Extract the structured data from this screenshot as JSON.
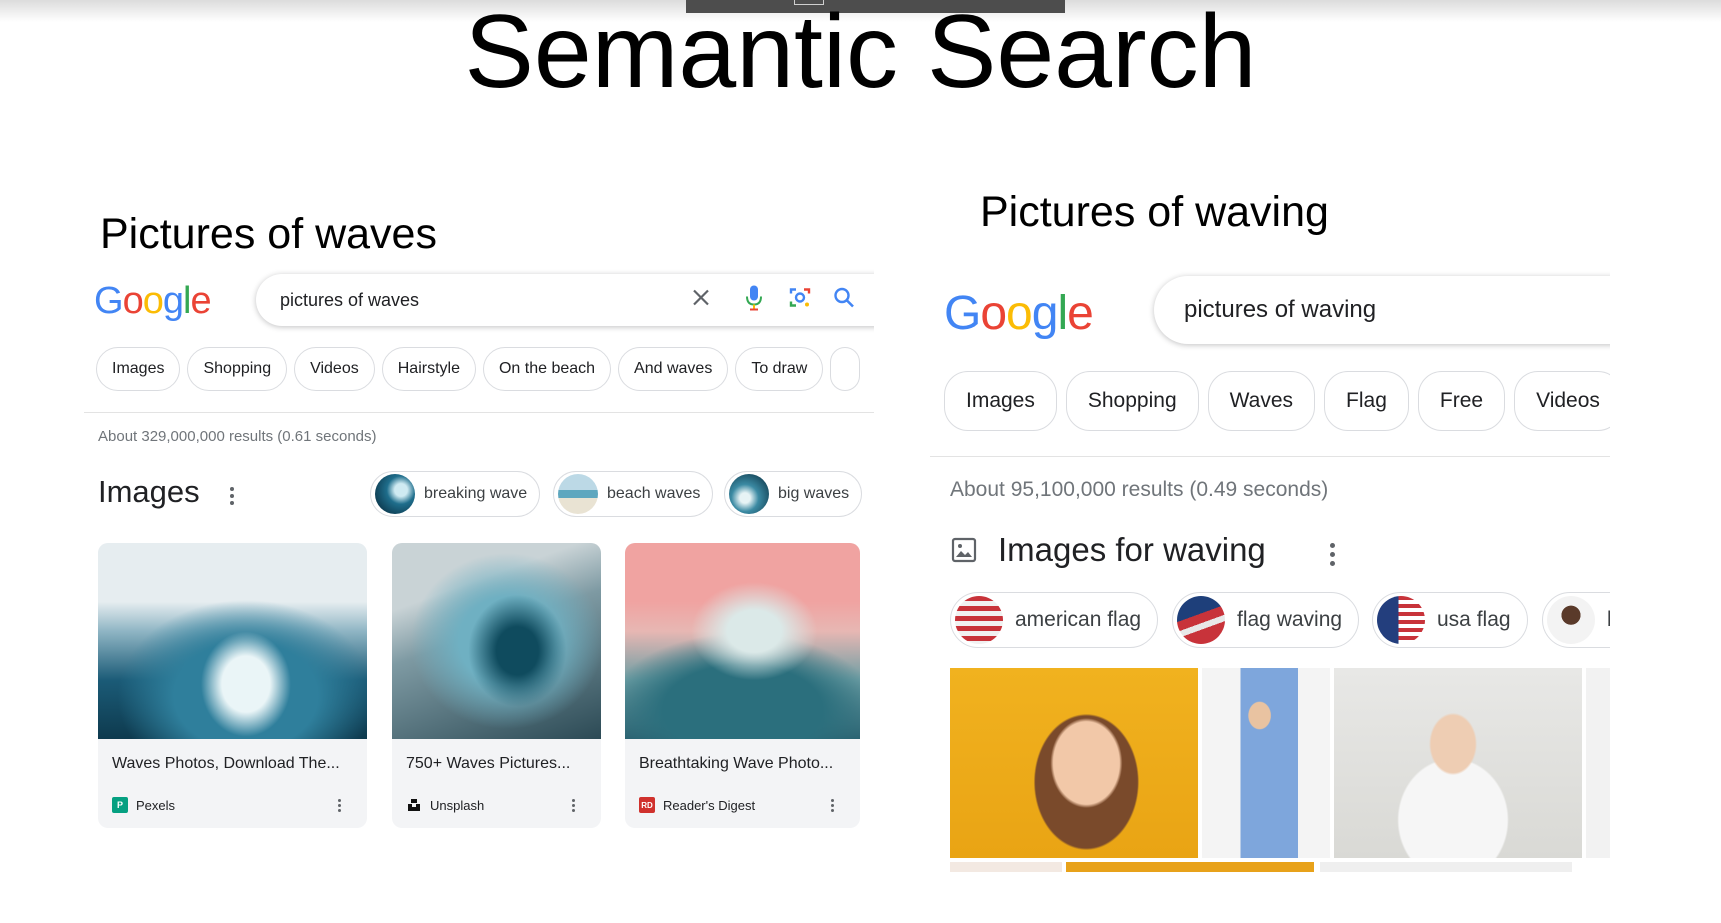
{
  "slide": {
    "title": "Semantic Search"
  },
  "left": {
    "heading": "Pictures of waves",
    "logo": [
      "G",
      "o",
      "o",
      "g",
      "l",
      "e"
    ],
    "search": {
      "value": "pictures of waves"
    },
    "chips": [
      "Images",
      "Shopping",
      "Videos",
      "Hairstyle",
      "On the beach",
      "And waves",
      "To draw"
    ],
    "result_count": "About 329,000,000 results (0.61 seconds)",
    "section_title": "Images",
    "related": [
      {
        "label": "breaking wave"
      },
      {
        "label": "beach waves"
      },
      {
        "label": "big waves"
      }
    ],
    "cards": [
      {
        "title": "Waves Photos, Download The...",
        "source": "Pexels",
        "favicon": "P",
        "favicon_color": "#05a081"
      },
      {
        "title": "750+ Waves Pictures...",
        "source": "Unsplash",
        "favicon": "",
        "favicon_color": "#111111"
      },
      {
        "title": "Breathtaking Wave Photo...",
        "source": "Reader's Digest",
        "favicon": "RD",
        "favicon_color": "#d0312d"
      }
    ]
  },
  "right": {
    "heading": "Pictures of waving",
    "logo": [
      "G",
      "o",
      "o",
      "g",
      "l",
      "e"
    ],
    "search": {
      "value": "pictures of waving"
    },
    "chips": [
      "Images",
      "Shopping",
      "Waves",
      "Flag",
      "Free",
      "Videos"
    ],
    "result_count": "About 95,100,000 results (0.49 seconds)",
    "section_title": "Images for waving",
    "related": [
      {
        "label": "american flag"
      },
      {
        "label": "flag waving"
      },
      {
        "label": "usa flag"
      },
      {
        "label": "b"
      }
    ]
  },
  "colors": {
    "google_blue": "#4285f4",
    "google_red": "#ea4335",
    "google_yellow": "#fbbc05",
    "google_green": "#34a853"
  }
}
